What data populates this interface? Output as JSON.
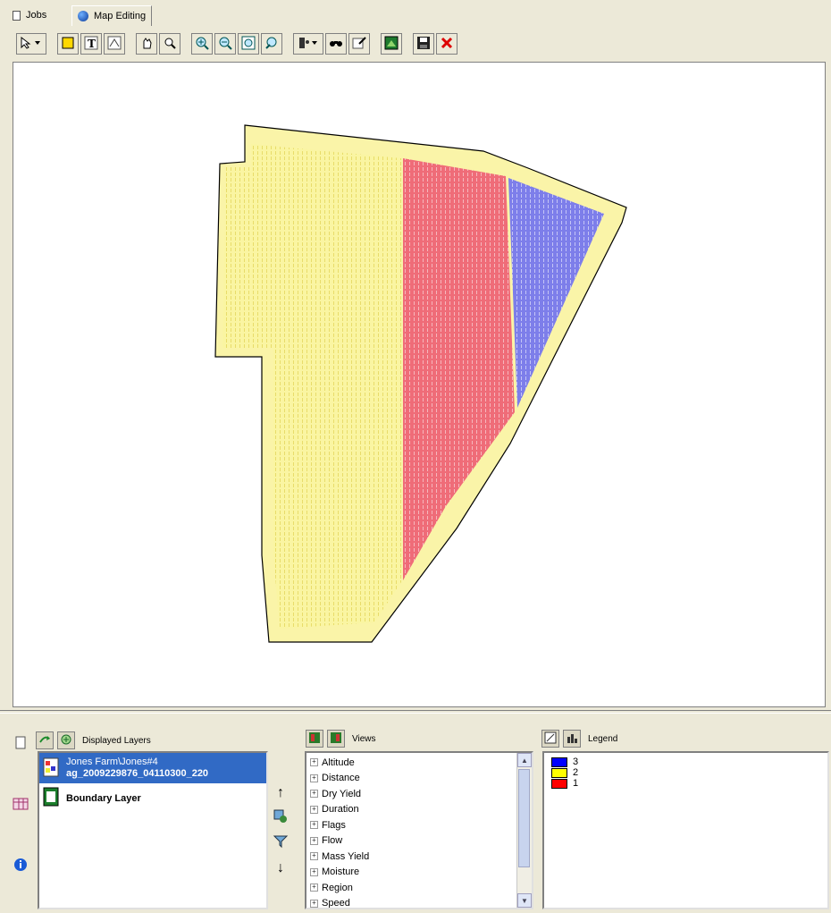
{
  "tabs": [
    {
      "label": "Jobs",
      "icon": "jobs-icon",
      "active": false
    },
    {
      "label": "Map Editing",
      "icon": "globe-icon",
      "active": true
    }
  ],
  "toolbar": {
    "buttons": [
      "select-dropdown-icon",
      "polygon-icon",
      "text-icon",
      "edit-vertices-icon",
      "pan-icon",
      "zoom-tool-icon",
      "zoom-in-icon",
      "zoom-out-icon",
      "zoom-extent-icon",
      "zoom-previous-icon",
      "info-dropdown-icon",
      "find-icon",
      "identify-icon",
      "map-image-icon",
      "save-icon",
      "close-icon"
    ]
  },
  "map": {
    "zone_colors": {
      "yellow": "#faf5a2",
      "red": "#ef6c78",
      "blue": "#7d7eea",
      "boundary": "#faf4a8"
    }
  },
  "layers": {
    "title": "Displayed Layers",
    "items": [
      {
        "line1": "Jones Farm\\Jones#4",
        "line2": "ag_2009229876_04110300_220",
        "selected": true,
        "icon": "map-layer-icon"
      },
      {
        "line1": "Boundary Layer",
        "line2": "",
        "selected": false,
        "icon": "boundary-layer-icon"
      }
    ]
  },
  "views": {
    "title": "Views",
    "items": [
      "Altitude",
      "Distance",
      "Dry Yield",
      "Duration",
      "Flags",
      "Flow",
      "Mass Yield",
      "Moisture",
      "Region",
      "Speed"
    ]
  },
  "legend": {
    "title": "Legend",
    "items": [
      {
        "label": "3",
        "color": "#0000ff"
      },
      {
        "label": "2",
        "color": "#ffff00"
      },
      {
        "label": "1",
        "color": "#ff0000"
      }
    ]
  }
}
